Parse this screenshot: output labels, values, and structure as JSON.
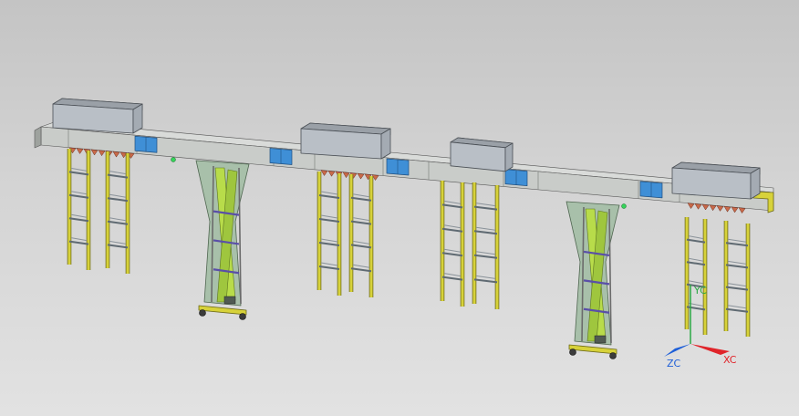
{
  "view": {
    "background_top": "#c4c4c4",
    "background_bottom": "#e2e2e2"
  },
  "colors": {
    "beam": "#c9ccc9",
    "beam_dark": "#9ea29e",
    "hopper": "#b9bfc6",
    "ladder": "#d7d23a",
    "ladder_dark": "#6d6a18",
    "support_panel": "#a8c0aa",
    "support_strut": "#b8dc4a",
    "connector": "#3f8fd6",
    "bracket": "#c96a4a",
    "axis_x": "#e0242a",
    "axis_y": "#2aa843",
    "axis_z": "#1e5fd8"
  },
  "triad": {
    "x_label": "XC",
    "y_label": "YC",
    "z_label": "ZC"
  }
}
